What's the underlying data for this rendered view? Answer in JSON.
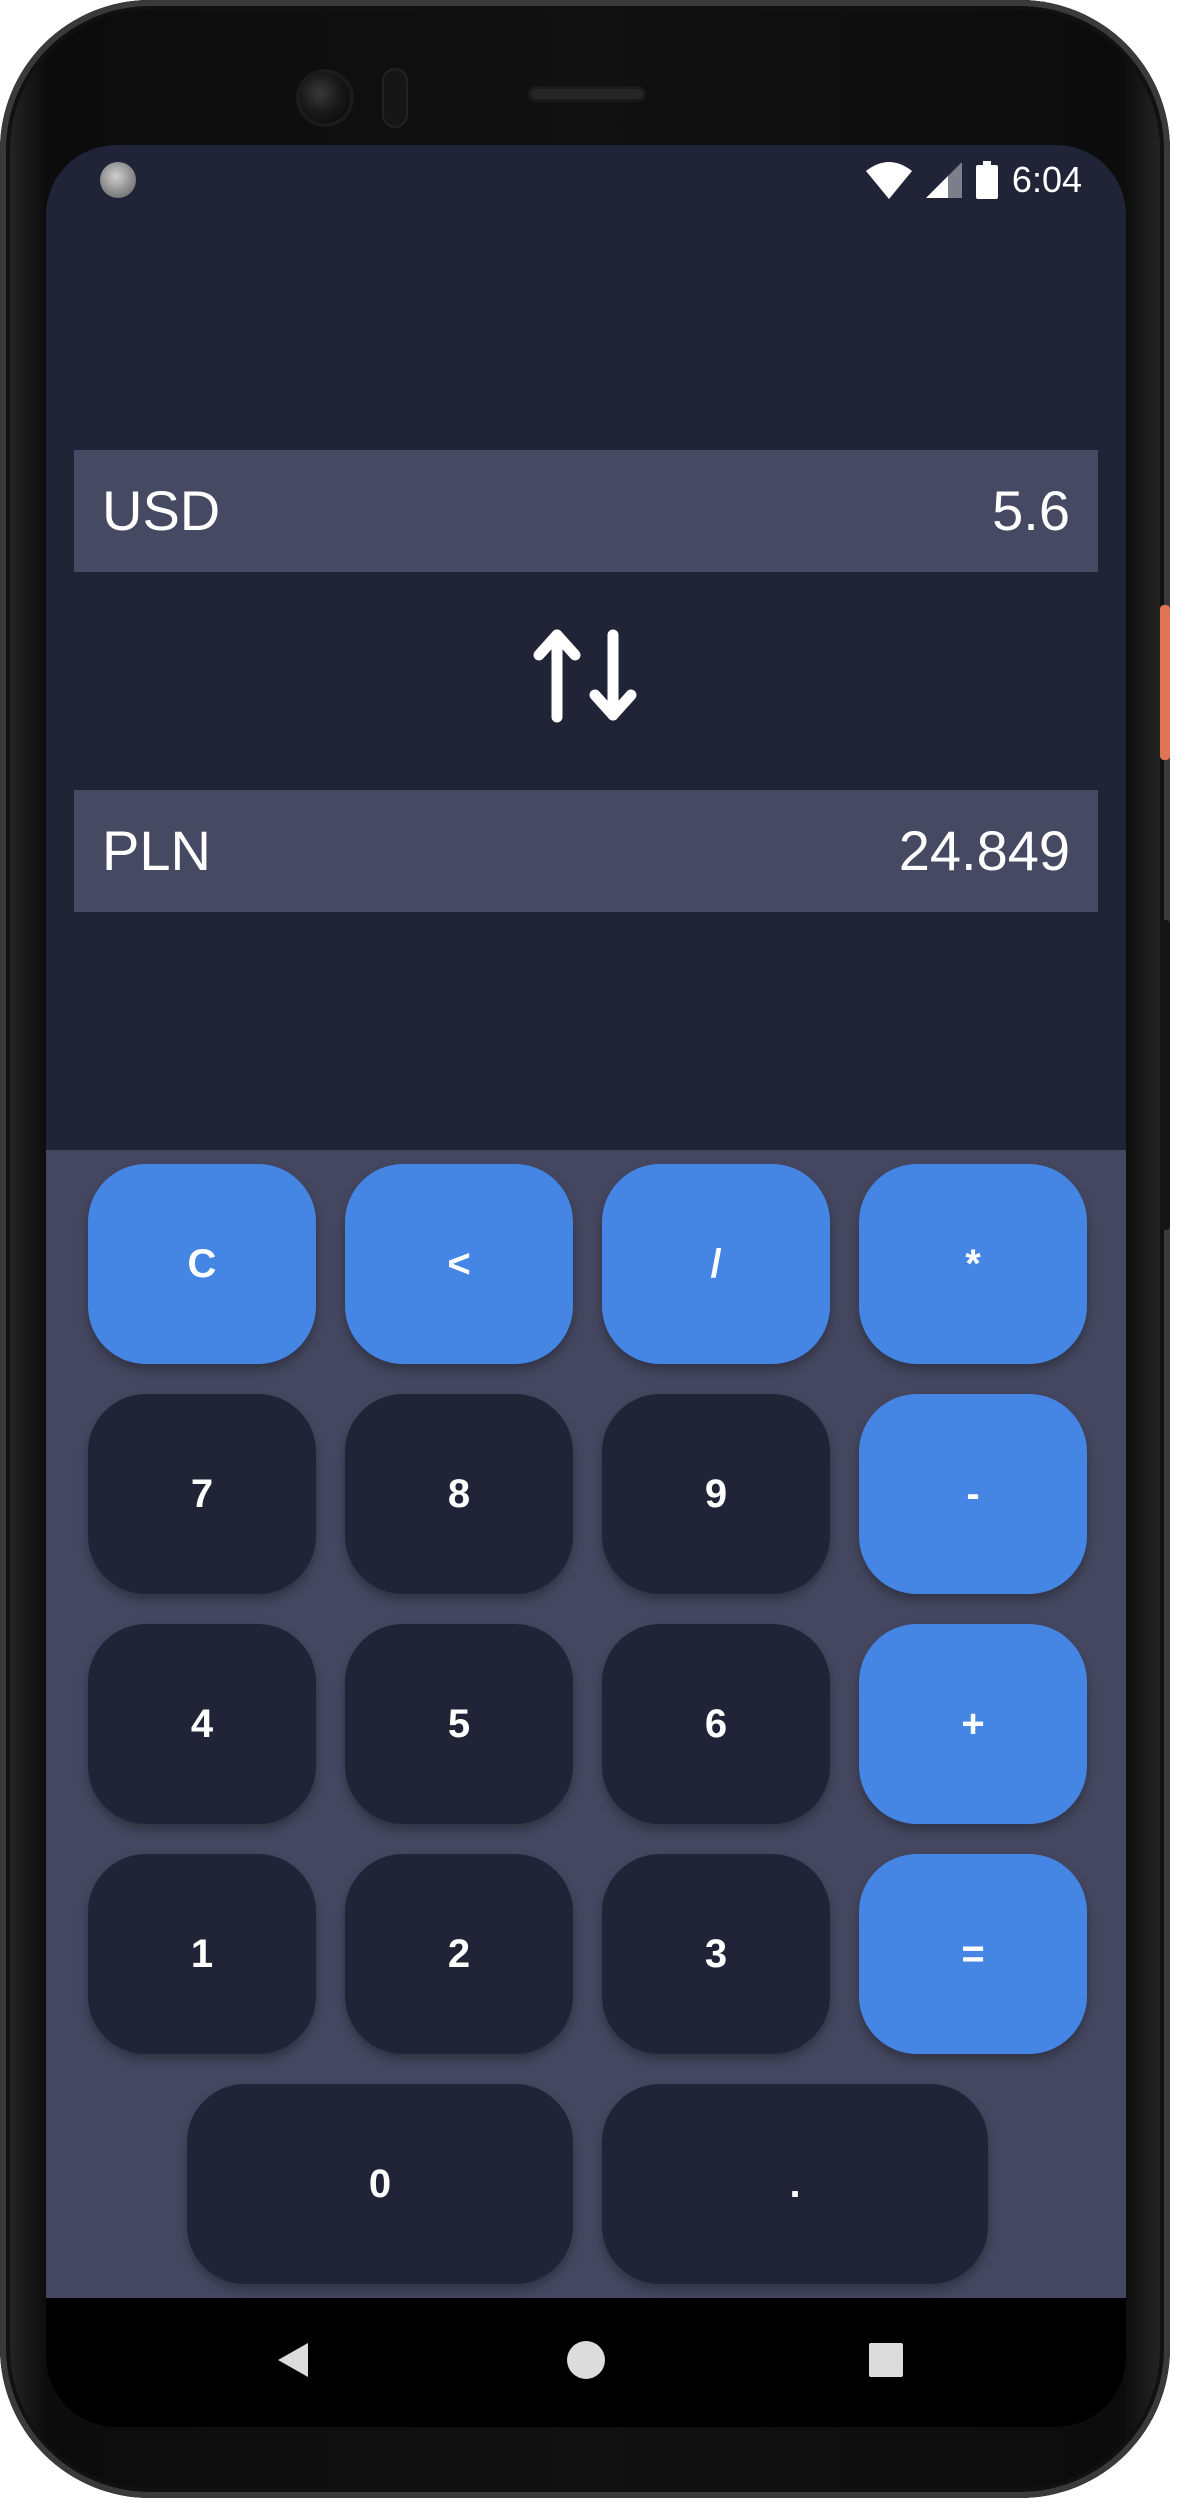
{
  "status_bar": {
    "time": "6:04",
    "icons": [
      "notification-dot-icon",
      "wifi-icon",
      "cellular-signal-icon",
      "battery-icon"
    ]
  },
  "converter": {
    "from": {
      "currency": "USD",
      "amount": "5.6"
    },
    "to": {
      "currency": "PLN",
      "amount": "24.849"
    },
    "swap_icon": "swap-arrows-icon"
  },
  "keypad": {
    "row1": [
      "C",
      "<",
      "/",
      "*"
    ],
    "row2": [
      "7",
      "8",
      "9",
      "-"
    ],
    "row3": [
      "4",
      "5",
      "6",
      "+"
    ],
    "row4": [
      "1",
      "2",
      "3",
      "="
    ],
    "row5": [
      "0",
      "."
    ]
  },
  "nav_bar": {
    "icons": [
      "back-icon",
      "home-icon",
      "recents-icon"
    ]
  },
  "colors": {
    "background": "#212436",
    "field": "#454961",
    "keypad_background": "#44475f",
    "operator_key": "#4585e4",
    "number_key": "#212436",
    "text": "#ffffff"
  }
}
